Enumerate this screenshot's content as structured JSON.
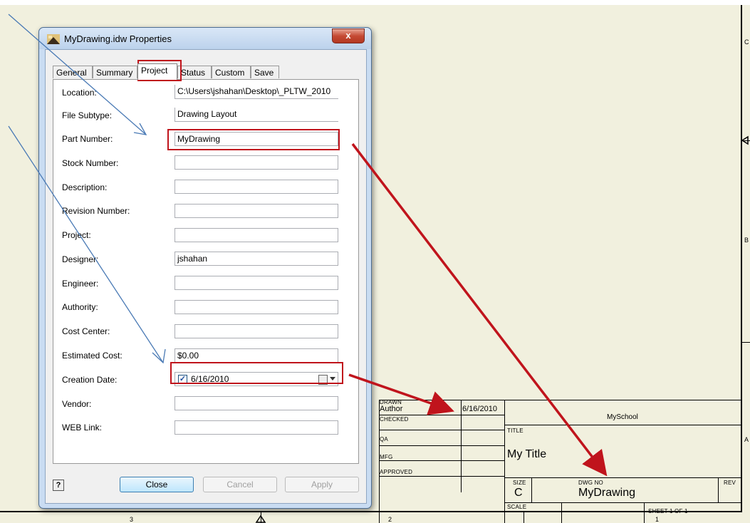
{
  "window": {
    "title": "MyDrawing.idw Properties",
    "close_glyph": "x"
  },
  "tabs": [
    {
      "label": "General"
    },
    {
      "label": "Summary"
    },
    {
      "label": "Project",
      "active": true
    },
    {
      "label": "Status"
    },
    {
      "label": "Custom"
    },
    {
      "label": "Save"
    }
  ],
  "fields": {
    "location": {
      "label": "Location:",
      "value": "C:\\Users\\jshahan\\Desktop\\_PLTW_2010"
    },
    "file_subtype": {
      "label": "File Subtype:",
      "value": "Drawing Layout"
    },
    "part_number": {
      "label": "Part Number:",
      "value": "MyDrawing"
    },
    "stock_number": {
      "label": "Stock Number:",
      "value": ""
    },
    "description": {
      "label": "Description:",
      "value": ""
    },
    "revision_number": {
      "label": "Revision Number:",
      "value": ""
    },
    "project": {
      "label": "Project:",
      "value": ""
    },
    "designer": {
      "label": "Designer:",
      "value": "jshahan"
    },
    "engineer": {
      "label": "Engineer:",
      "value": ""
    },
    "authority": {
      "label": "Authority:",
      "value": ""
    },
    "cost_center": {
      "label": "Cost Center:",
      "value": ""
    },
    "estimated_cost": {
      "label": "Estimated Cost:",
      "value": "$0.00"
    },
    "creation_date": {
      "label": "Creation Date:",
      "value": "6/16/2010",
      "checked": true,
      "check_glyph": "✓"
    },
    "vendor": {
      "label": "Vendor:",
      "value": ""
    },
    "web_link": {
      "label": "WEB Link:",
      "value": ""
    }
  },
  "buttons": {
    "help": "?",
    "close": "Close",
    "cancel": "Cancel",
    "apply": "Apply"
  },
  "sheet": {
    "zone_letters": [
      "C",
      "B",
      "A"
    ],
    "zone_numbers": [
      "3",
      "2",
      "1"
    ],
    "title_block": {
      "drawn_label": "DRAWN",
      "drawn_by": "Author",
      "drawn_date": "6/16/2010",
      "checked_label": "CHECKED",
      "qa_label": "QA",
      "mfg_label": "MFG",
      "approved_label": "APPROVED",
      "company": "MySchool",
      "title_label": "TITLE",
      "title": "My Title",
      "size_label": "SIZE",
      "size": "C",
      "dwg_no_label": "DWG NO",
      "dwg_no": "MyDrawing",
      "rev_label": "REV",
      "scale_label": "SCALE",
      "sheet": "SHEET 1  OF 1"
    }
  },
  "colors": {
    "sheet_background": "#f1f0de",
    "annotation_red": "#c0141c",
    "annotation_blue": "#4a7ab5"
  }
}
